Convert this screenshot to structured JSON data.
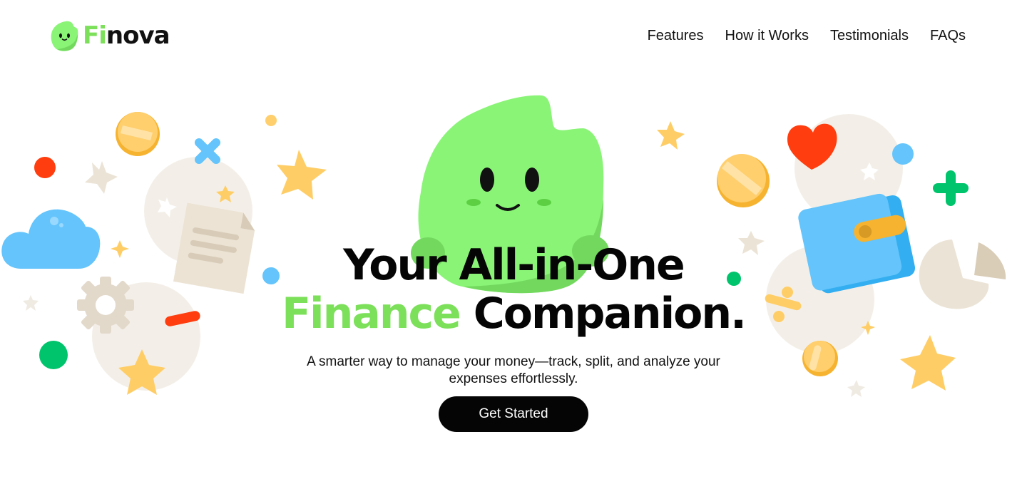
{
  "brand": {
    "name_accent": "Fi",
    "name_rest": "nova",
    "icon": "leaf-mascot-icon",
    "accent_color": "#7ce05a"
  },
  "nav": {
    "items": [
      {
        "label": "Features"
      },
      {
        "label": "How it Works"
      },
      {
        "label": "Testimonials"
      },
      {
        "label": "FAQs"
      }
    ]
  },
  "hero": {
    "title_line1": "Your All-in-One",
    "title_green": "Finance",
    "title_dark": "Companion.",
    "subtitle": "A smarter way to manage your money—track, split, and analyze your expenses effortlessly.",
    "cta_label": "Get Started"
  },
  "colors": {
    "mascot_green": "#8af477",
    "mascot_green_dark": "#72d95e",
    "coin_yellow": "#ffcf6e",
    "star_yellow": "#ffcd66",
    "cloud_blue": "#64c4fb",
    "heart_red": "#ff3d0e",
    "dot_green": "#00c46b",
    "beige": "#f3efe8",
    "text_dark": "#050505"
  }
}
